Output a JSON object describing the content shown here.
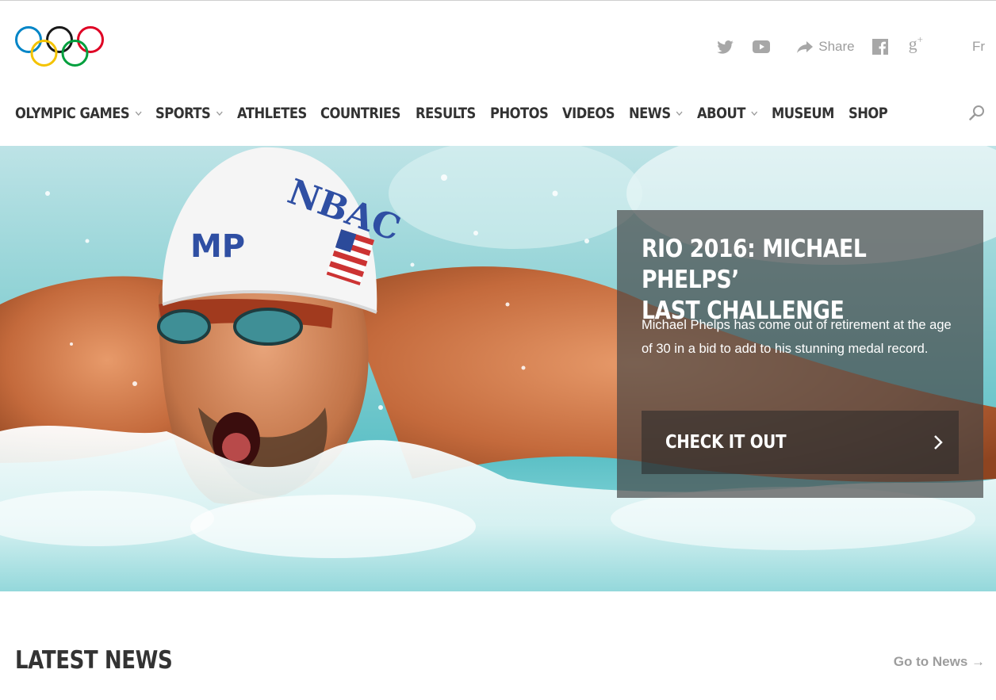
{
  "header": {
    "logo_alt": "Olympic rings",
    "social": {
      "twitter_icon": "twitter-icon",
      "youtube_icon": "youtube-icon",
      "share_label": "Share",
      "facebook_icon": "facebook-icon",
      "gplus_label": "g+",
      "language": "Fr"
    }
  },
  "nav": {
    "items": [
      {
        "label": "OLYMPIC GAMES",
        "has_dropdown": true
      },
      {
        "label": "SPORTS",
        "has_dropdown": true
      },
      {
        "label": "ATHLETES",
        "has_dropdown": false
      },
      {
        "label": "COUNTRIES",
        "has_dropdown": false
      },
      {
        "label": "RESULTS",
        "has_dropdown": false
      },
      {
        "label": "PHOTOS",
        "has_dropdown": false
      },
      {
        "label": "VIDEOS",
        "has_dropdown": false
      },
      {
        "label": "NEWS",
        "has_dropdown": true
      },
      {
        "label": "ABOUT",
        "has_dropdown": true
      },
      {
        "label": "MUSEUM",
        "has_dropdown": false
      },
      {
        "label": "SHOP",
        "has_dropdown": false
      }
    ],
    "search_icon": "search-icon"
  },
  "hero": {
    "title_line1": "RIO 2016: MICHAEL PHELPS’",
    "title_line2": "LAST CHALLENGE",
    "text": "Michael Phelps has come out of retirement at the age of 30 in a bid to add to his stunning medal record.",
    "cta_label": "CHECK IT OUT",
    "cap_text_logo": "MP",
    "cap_text_team": "NBAC"
  },
  "latest_news": {
    "title": "LATEST NEWS",
    "link_label": "Go to News →"
  },
  "colors": {
    "rings": [
      "#0085c7",
      "#000000",
      "#df0024",
      "#f4c300",
      "#009f3d"
    ],
    "nav_text": "#333333",
    "muted": "#9d9d9d",
    "caption_bg": "rgba(70,70,70,0.68)"
  }
}
